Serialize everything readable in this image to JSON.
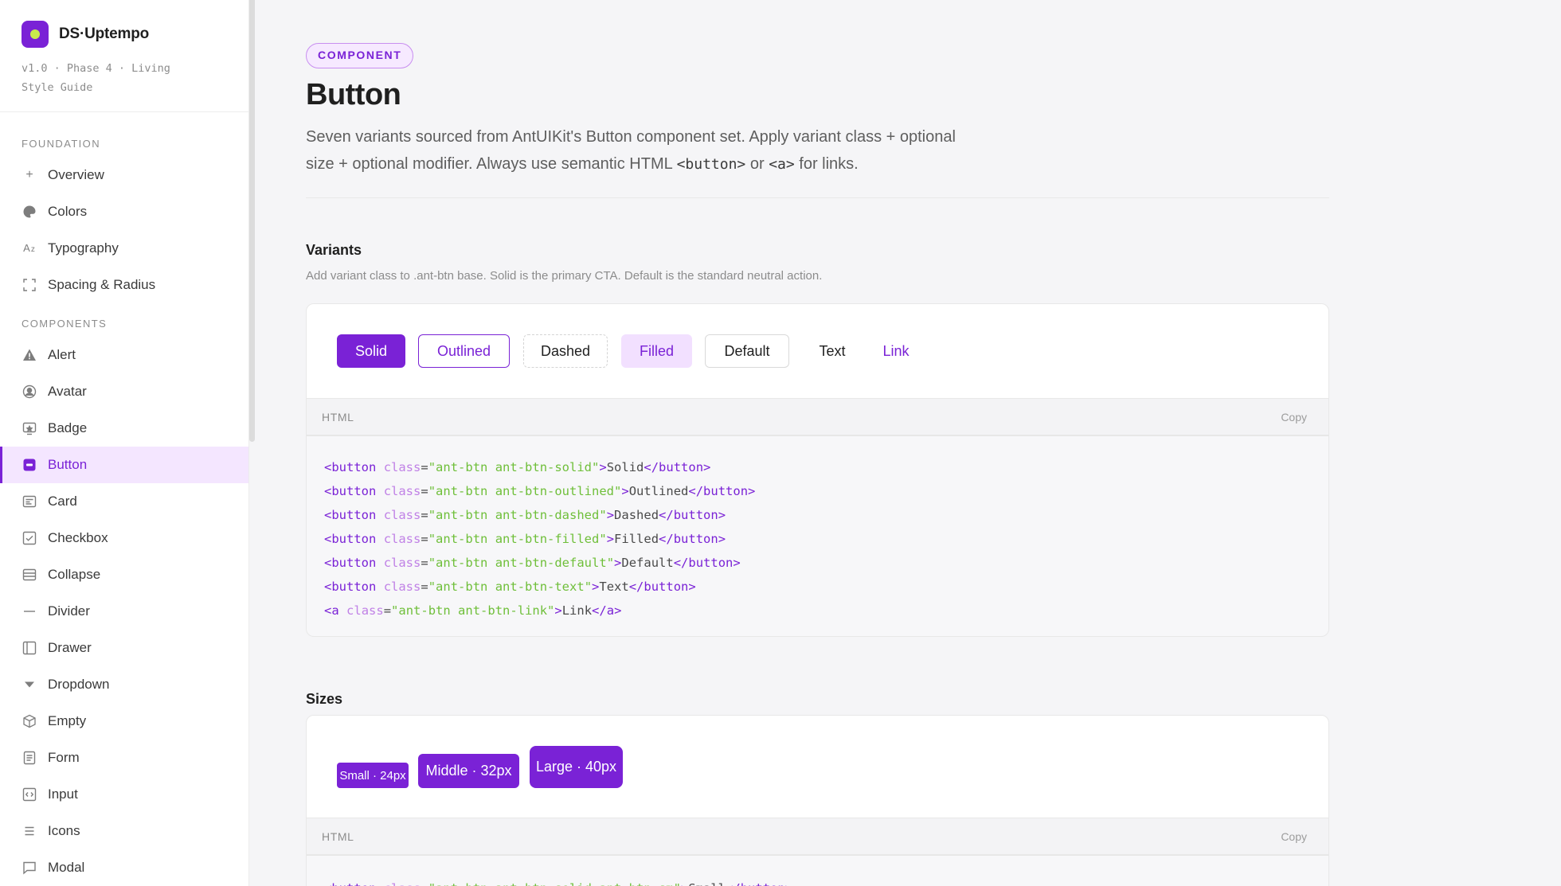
{
  "brand": {
    "name": "DS·Uptempo",
    "subtitle": "v1.0 · Phase 4 · Living Style Guide"
  },
  "sidebar": {
    "foundation_label": "FOUNDATION",
    "foundation": [
      {
        "label": "Overview",
        "icon": "plus-icon"
      },
      {
        "label": "Colors",
        "icon": "palette-icon"
      },
      {
        "label": "Typography",
        "icon": "typography-icon"
      },
      {
        "label": "Spacing & Radius",
        "icon": "frame-icon"
      }
    ],
    "components_label": "COMPONENTS",
    "components": [
      {
        "label": "Alert",
        "icon": "warning-icon"
      },
      {
        "label": "Avatar",
        "icon": "user-circle-icon"
      },
      {
        "label": "Badge",
        "icon": "badge-icon"
      },
      {
        "label": "Button",
        "icon": "button-icon",
        "active": true
      },
      {
        "label": "Card",
        "icon": "card-icon"
      },
      {
        "label": "Checkbox",
        "icon": "checkbox-icon"
      },
      {
        "label": "Collapse",
        "icon": "collapse-icon"
      },
      {
        "label": "Divider",
        "icon": "divider-icon"
      },
      {
        "label": "Drawer",
        "icon": "drawer-icon"
      },
      {
        "label": "Dropdown",
        "icon": "caret-down-icon"
      },
      {
        "label": "Empty",
        "icon": "box-icon"
      },
      {
        "label": "Form",
        "icon": "form-icon"
      },
      {
        "label": "Input",
        "icon": "input-icon"
      },
      {
        "label": "Icons",
        "icon": "menu-icon"
      },
      {
        "label": "Modal",
        "icon": "modal-icon"
      }
    ]
  },
  "header": {
    "eyebrow": "COMPONENT",
    "title": "Button",
    "lead_1": "Seven variants sourced from AntUIKit's Button component set. Apply variant class + optional",
    "lead_2a": "size + optional modifier. Always use semantic HTML ",
    "lead_code1": "<button>",
    "lead_2b": " or ",
    "lead_code2": "<a>",
    "lead_2c": " for links."
  },
  "variants": {
    "title": "Variants",
    "description": "Add variant class to .ant-btn base. Solid is the primary CTA. Default is the standard neutral action.",
    "buttons": {
      "solid": "Solid",
      "outlined": "Outlined",
      "dashed": "Dashed",
      "filled": "Filled",
      "default": "Default",
      "text": "Text",
      "link": "Link"
    },
    "code_label": "HTML",
    "copy_label": "Copy",
    "code": [
      {
        "tag": "button",
        "cls": "ant-btn ant-btn-solid",
        "text": "Solid"
      },
      {
        "tag": "button",
        "cls": "ant-btn ant-btn-outlined",
        "text": "Outlined"
      },
      {
        "tag": "button",
        "cls": "ant-btn ant-btn-dashed",
        "text": "Dashed"
      },
      {
        "tag": "button",
        "cls": "ant-btn ant-btn-filled",
        "text": "Filled"
      },
      {
        "tag": "button",
        "cls": "ant-btn ant-btn-default",
        "text": "Default"
      },
      {
        "tag": "button",
        "cls": "ant-btn ant-btn-text",
        "text": "Text"
      },
      {
        "tag": "a",
        "cls": "ant-btn ant-btn-link",
        "text": "Link"
      }
    ]
  },
  "sizes": {
    "title": "Sizes",
    "buttons": {
      "small": "Small · 24px",
      "middle": "Middle · 32px",
      "large": "Large · 40px"
    },
    "code_label": "HTML",
    "copy_label": "Copy",
    "code": [
      {
        "tag": "button",
        "cls": "ant-btn ant-btn-solid ant-btn-sm",
        "text": "Small"
      }
    ]
  },
  "colors": {
    "accent": "#7a22d6",
    "accent_light": "#f2e0ff",
    "string": "#6fbf3a",
    "attr": "#c081e6"
  }
}
